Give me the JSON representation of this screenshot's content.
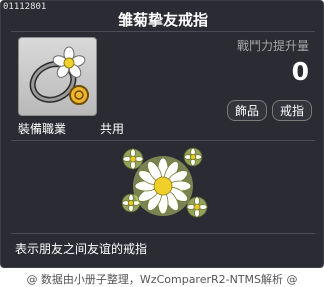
{
  "item": {
    "id": "01112801",
    "title": "雏菊挚友戒指",
    "stat_label": "戰鬥力提升量",
    "stat_value": "0",
    "tags": [
      "飾品",
      "戒指"
    ],
    "job_label": "裝備職業",
    "job_value": "共用",
    "description": "表示朋友之间友谊的戒指"
  },
  "footer": "@ 数据由小册子整理，WzComparerR2-NTMS解析 @"
}
